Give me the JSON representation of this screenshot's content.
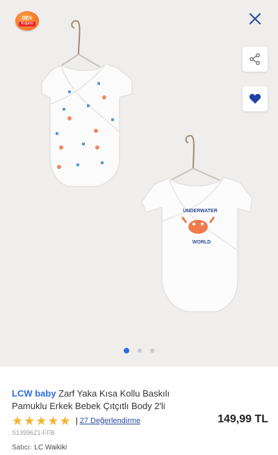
{
  "badge": {
    "line1": "DEV",
    "line2": "Kupon"
  },
  "icons": {
    "close": "close-icon",
    "share": "share-icon",
    "favorite": "heart-icon",
    "star": "star-icon"
  },
  "colors": {
    "brand_blue": "#2f6fd8",
    "star": "#f3b531",
    "favorite": "#2040a8",
    "dot_active": "#2f6fd8"
  },
  "gallery": {
    "page_count": 3,
    "active_index": 0
  },
  "product": {
    "brand": "LCW baby",
    "name": " Zarf Yaka Kısa Kollu Baskılı Pamuklu Erkek Bebek Çıtçıtlı Body 2'li",
    "rating_stars": 5,
    "review_link": "27 Değerlendirme",
    "price": "149,99 TL",
    "code": "S13996Z1-FFB",
    "seller_label": "Satıcı:",
    "seller_name": "LC Waikiki",
    "print_text_1": "UNDERWATER",
    "print_text_2": "WORLD"
  }
}
